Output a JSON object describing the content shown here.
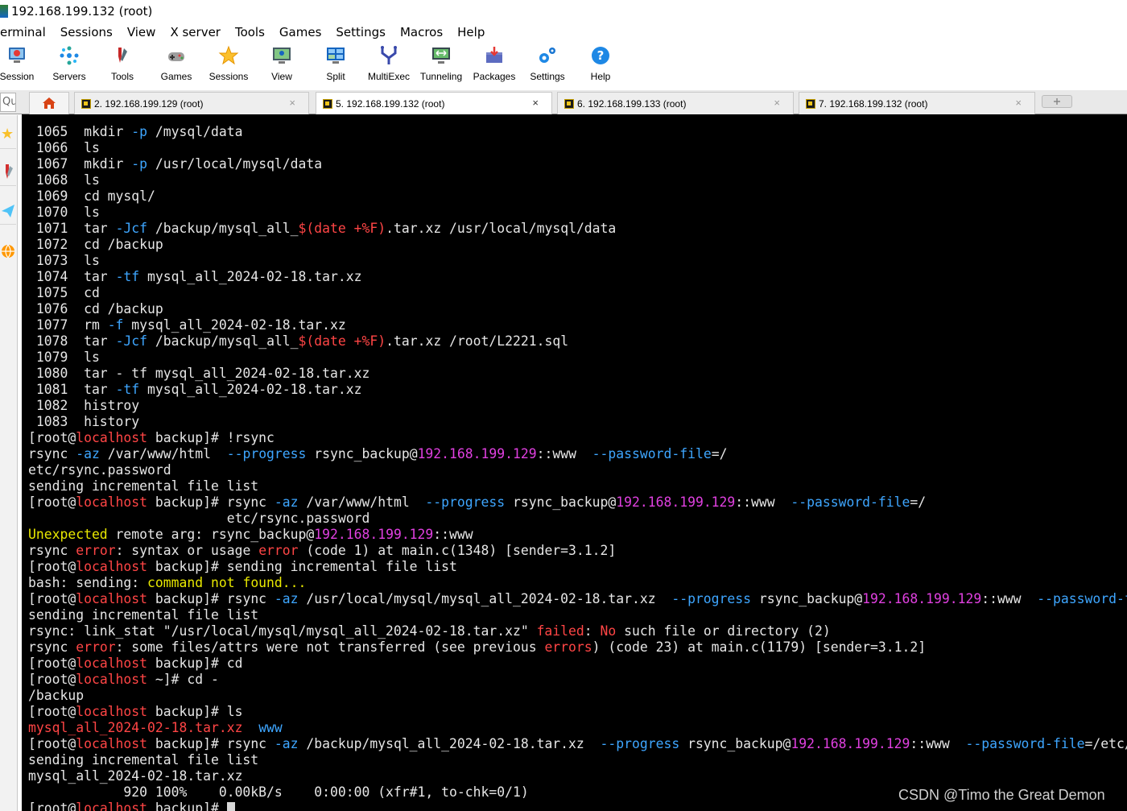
{
  "window": {
    "title": "192.168.199.132 (root)"
  },
  "menu": [
    "erminal",
    "Sessions",
    "View",
    "X server",
    "Tools",
    "Games",
    "Settings",
    "Macros",
    "Help"
  ],
  "toolbar": [
    {
      "label": "Session",
      "icon": "session-icon"
    },
    {
      "label": "Servers",
      "icon": "servers-icon"
    },
    {
      "label": "Tools",
      "icon": "tools-icon"
    },
    {
      "label": "Games",
      "icon": "games-icon"
    },
    {
      "label": "Sessions",
      "icon": "star-icon"
    },
    {
      "label": "View",
      "icon": "view-icon"
    },
    {
      "label": "Split",
      "icon": "split-icon"
    },
    {
      "label": "MultiExec",
      "icon": "multiexec-icon"
    },
    {
      "label": "Tunneling",
      "icon": "tunneling-icon"
    },
    {
      "label": "Packages",
      "icon": "packages-icon"
    },
    {
      "label": "Settings",
      "icon": "settings-icon"
    },
    {
      "label": "Help",
      "icon": "help-icon"
    }
  ],
  "quick_connect": {
    "placeholder": "Qu"
  },
  "tabs": [
    {
      "label": "2. 192.168.199.129 (root)",
      "close": "×"
    },
    {
      "label": "5. 192.168.199.132 (root)",
      "close": "×",
      "active": true
    },
    {
      "label": "6. 192.168.199.133 (root)",
      "close": "×"
    },
    {
      "label": "7. 192.168.199.132 (root)",
      "close": "×"
    }
  ],
  "terminal": {
    "lines": [
      [
        {
          "t": " 1065  mkdir "
        },
        {
          "t": "-p",
          "c": "blue"
        },
        {
          "t": " /mysql/data"
        }
      ],
      [
        {
          "t": " 1066  ls"
        }
      ],
      [
        {
          "t": " 1067  mkdir "
        },
        {
          "t": "-p",
          "c": "blue"
        },
        {
          "t": " /usr/local/mysql/data"
        }
      ],
      [
        {
          "t": " 1068  ls"
        }
      ],
      [
        {
          "t": " 1069  cd mysql/"
        }
      ],
      [
        {
          "t": " 1070  ls"
        }
      ],
      [
        {
          "t": " 1071  tar "
        },
        {
          "t": "-Jcf",
          "c": "blue"
        },
        {
          "t": " /backup/mysql_all_"
        },
        {
          "t": "$(date +%F)",
          "c": "red"
        },
        {
          "t": ".tar.xz /usr/local/mysql/data"
        }
      ],
      [
        {
          "t": " 1072  cd /backup"
        }
      ],
      [
        {
          "t": " 1073  ls"
        }
      ],
      [
        {
          "t": " 1074  tar "
        },
        {
          "t": "-tf",
          "c": "blue"
        },
        {
          "t": " mysql_all_2024-02-18.tar.xz"
        }
      ],
      [
        {
          "t": " 1075  cd"
        }
      ],
      [
        {
          "t": " 1076  cd /backup"
        }
      ],
      [
        {
          "t": " 1077  rm "
        },
        {
          "t": "-f",
          "c": "blue"
        },
        {
          "t": " mysql_all_2024-02-18.tar.xz"
        }
      ],
      [
        {
          "t": " 1078  tar "
        },
        {
          "t": "-Jcf",
          "c": "blue"
        },
        {
          "t": " /backup/mysql_all_"
        },
        {
          "t": "$(date +%F)",
          "c": "red"
        },
        {
          "t": ".tar.xz /root/L2221.sql"
        }
      ],
      [
        {
          "t": " 1079  ls"
        }
      ],
      [
        {
          "t": " 1080  tar - tf mysql_all_2024-02-18.tar.xz"
        }
      ],
      [
        {
          "t": " 1081  tar "
        },
        {
          "t": "-tf",
          "c": "blue"
        },
        {
          "t": " mysql_all_2024-02-18.tar.xz"
        }
      ],
      [
        {
          "t": " 1082  histroy"
        }
      ],
      [
        {
          "t": " 1083  history"
        }
      ],
      [
        {
          "t": "[root@"
        },
        {
          "t": "localhost",
          "c": "red"
        },
        {
          "t": " backup]# !rsync"
        }
      ],
      [
        {
          "t": "rsync "
        },
        {
          "t": "-az",
          "c": "blue"
        },
        {
          "t": " /var/www/html  "
        },
        {
          "t": "--progress",
          "c": "blue"
        },
        {
          "t": " rsync_backup@"
        },
        {
          "t": "192.168.199.129",
          "c": "mag"
        },
        {
          "t": "::www  "
        },
        {
          "t": "--password-file",
          "c": "blue"
        },
        {
          "t": "=/"
        }
      ],
      [
        {
          "t": "etc/rsync.password"
        }
      ],
      [
        {
          "t": "sending incremental file list"
        }
      ],
      [
        {
          "t": "[root@"
        },
        {
          "t": "localhost",
          "c": "red"
        },
        {
          "t": " backup]# rsync "
        },
        {
          "t": "-az",
          "c": "blue"
        },
        {
          "t": " /var/www/html  "
        },
        {
          "t": "--progress",
          "c": "blue"
        },
        {
          "t": " rsync_backup@"
        },
        {
          "t": "192.168.199.129",
          "c": "mag"
        },
        {
          "t": "::www  "
        },
        {
          "t": "--password-file",
          "c": "blue"
        },
        {
          "t": "=/"
        }
      ],
      [
        {
          "t": "                         etc/rsync.password"
        }
      ],
      [
        {
          "t": "Unexpected",
          "c": "yel"
        },
        {
          "t": " remote arg: rsync_backup@"
        },
        {
          "t": "192.168.199.129",
          "c": "mag"
        },
        {
          "t": "::www"
        }
      ],
      [
        {
          "t": "rsync "
        },
        {
          "t": "error",
          "c": "red"
        },
        {
          "t": ": syntax or usage "
        },
        {
          "t": "error",
          "c": "red"
        },
        {
          "t": " (code 1) at main.c(1348) [sender=3.1.2]"
        }
      ],
      [
        {
          "t": "[root@"
        },
        {
          "t": "localhost",
          "c": "red"
        },
        {
          "t": " backup]# sending incremental file list"
        }
      ],
      [
        {
          "t": "bash: sending: "
        },
        {
          "t": "command not found...",
          "c": "yel"
        }
      ],
      [
        {
          "t": "[root@"
        },
        {
          "t": "localhost",
          "c": "red"
        },
        {
          "t": " backup]# rsync "
        },
        {
          "t": "-az",
          "c": "blue"
        },
        {
          "t": " /usr/local/mysql/mysql_all_2024-02-18.tar.xz  "
        },
        {
          "t": "--progress",
          "c": "blue"
        },
        {
          "t": " rsync_backup@"
        },
        {
          "t": "192.168.199.129",
          "c": "mag"
        },
        {
          "t": "::www  "
        },
        {
          "t": "--password-file",
          "c": "blue"
        }
      ],
      [
        {
          "t": "sending incremental file list"
        }
      ],
      [
        {
          "t": "rsync: link_stat \"/usr/local/mysql/mysql_all_2024-02-18.tar.xz\" "
        },
        {
          "t": "failed",
          "c": "red"
        },
        {
          "t": ": "
        },
        {
          "t": "No",
          "c": "red"
        },
        {
          "t": " such file or directory (2)"
        }
      ],
      [
        {
          "t": "rsync "
        },
        {
          "t": "error",
          "c": "red"
        },
        {
          "t": ": some files/attrs were not transferred (see previous "
        },
        {
          "t": "errors",
          "c": "red"
        },
        {
          "t": ") (code 23) at main.c(1179) [sender=3.1.2]"
        }
      ],
      [
        {
          "t": "[root@"
        },
        {
          "t": "localhost",
          "c": "red"
        },
        {
          "t": " backup]# cd"
        }
      ],
      [
        {
          "t": "[root@"
        },
        {
          "t": "localhost",
          "c": "red"
        },
        {
          "t": " ~]# cd -"
        }
      ],
      [
        {
          "t": "/backup"
        }
      ],
      [
        {
          "t": "[root@"
        },
        {
          "t": "localhost",
          "c": "red"
        },
        {
          "t": " backup]# ls"
        }
      ],
      [
        {
          "t": "mysql_all_2024-02-18.tar.xz",
          "c": "red"
        },
        {
          "t": "  "
        },
        {
          "t": "www",
          "c": "blue"
        }
      ],
      [
        {
          "t": "[root@"
        },
        {
          "t": "localhost",
          "c": "red"
        },
        {
          "t": " backup]# rsync "
        },
        {
          "t": "-az",
          "c": "blue"
        },
        {
          "t": " /backup/mysql_all_2024-02-18.tar.xz  "
        },
        {
          "t": "--progress",
          "c": "blue"
        },
        {
          "t": " rsync_backup@"
        },
        {
          "t": "192.168.199.129",
          "c": "mag"
        },
        {
          "t": "::www  "
        },
        {
          "t": "--password-file",
          "c": "blue"
        },
        {
          "t": "=/etc/rsync.password"
        }
      ],
      [
        {
          "t": "sending incremental file list"
        }
      ],
      [
        {
          "t": "mysql_all_2024-02-18.tar.xz"
        }
      ],
      [
        {
          "t": "            920 100%    0.00kB/s    0:00:00 (xfr#1, to-chk=0/1)"
        }
      ],
      [
        {
          "t": "[root@"
        },
        {
          "t": "localhost",
          "c": "red"
        },
        {
          "t": " backup]# "
        }
      ]
    ]
  },
  "watermark": "CSDN @Timo the Great Demon",
  "colors": {
    "terminal_bg": "#000000",
    "text": "#e6e6e6",
    "red": "#ff4545",
    "magenta": "#e040e0",
    "blue": "#3ea6ff",
    "yellow": "#e8e800"
  }
}
